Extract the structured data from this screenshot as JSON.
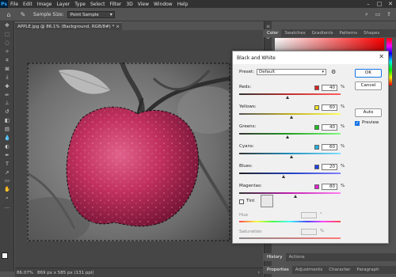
{
  "app": {
    "logo_text": "Ps"
  },
  "menu": [
    "File",
    "Edit",
    "Image",
    "Layer",
    "Type",
    "Select",
    "Filter",
    "3D",
    "View",
    "Window",
    "Help"
  ],
  "window_controls": [
    "–",
    "□",
    "✕"
  ],
  "options": {
    "sample_size_label": "Sample Size:",
    "sample_size_value": "Point Sample"
  },
  "document": {
    "tab_title": "APPLE.jpg @ 86.1% (Background, RGB/8#) *",
    "close": "×",
    "zoom": "86.07%",
    "info": "869 px x 585 px (131 ppi)"
  },
  "panels": {
    "top_tabs": [
      "Color",
      "Swatches",
      "Gradients",
      "Patterns",
      "Shapes"
    ],
    "history_tabs": [
      "History",
      "Actions"
    ],
    "properties_tabs": [
      "Properties",
      "Adjustments",
      "Character",
      "Paragraph"
    ]
  },
  "dialog": {
    "title": "Black and White",
    "close": "✕",
    "preset_label": "Preset:",
    "preset_value": "Default",
    "sliders": [
      {
        "label": "Reds:",
        "value": "40",
        "color": "#e02020",
        "pos": 40,
        "ramp": "reds"
      },
      {
        "label": "Yellows:",
        "value": "60",
        "color": "#f0e020",
        "pos": 60,
        "ramp": "yellows"
      },
      {
        "label": "Greens:",
        "value": "40",
        "color": "#20c020",
        "pos": 40,
        "ramp": "greens"
      },
      {
        "label": "Cyans:",
        "value": "60",
        "color": "#20b0e0",
        "pos": 60,
        "ramp": "cyans"
      },
      {
        "label": "Blues:",
        "value": "20",
        "color": "#2040e0",
        "pos": 20,
        "ramp": "blues"
      },
      {
        "label": "Magentas:",
        "value": "80",
        "color": "#e020d0",
        "pos": 80,
        "ramp": "magentas"
      }
    ],
    "percent": "%",
    "buttons": {
      "ok": "OK",
      "cancel": "Cancel",
      "auto": "Auto"
    },
    "preview_label": "Preview",
    "tint_label": "Tint",
    "hue_label": "Hue",
    "hue_unit": "°",
    "saturation_label": "Saturation",
    "saturation_unit": "%"
  }
}
